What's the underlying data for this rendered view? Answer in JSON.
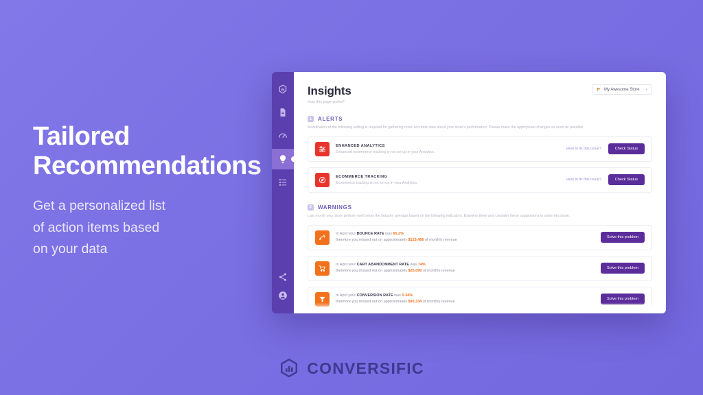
{
  "promo": {
    "title_line1": "Tailored",
    "title_line2": "Recommendations",
    "sub_line1": "Get a personalized list",
    "sub_line2": "of action items based",
    "sub_line3": "on your data"
  },
  "brand": {
    "name": "CONVERSIFIC",
    "logo_icon": "hexagon-bar-chart-icon",
    "color": "#3f3a8f"
  },
  "app": {
    "sidebar": {
      "items": [
        {
          "icon": "hexagon-logo-icon",
          "active": false
        },
        {
          "icon": "document-icon",
          "active": false
        },
        {
          "icon": "gauge-icon",
          "active": false
        },
        {
          "icon": "lightbulb-icon",
          "active": true
        },
        {
          "icon": "list-icon",
          "active": false
        }
      ],
      "bottom_items": [
        {
          "icon": "share-icon",
          "active": false
        },
        {
          "icon": "user-avatar-icon",
          "active": false
        }
      ]
    },
    "header": {
      "title": "Insights",
      "subtitle": "How this page works?",
      "store_selector": {
        "value": "My Awesome Store",
        "icon": "store-flag-icon",
        "caret": "chevron-down-icon"
      }
    },
    "sections": [
      {
        "number": "1",
        "title": "ALERTS",
        "description": "Modification of the following setting is required for gathering more accurate data about your store's performance. Please make the appropriate changes as soon as possible.",
        "cards": [
          {
            "icon": "sliders-icon",
            "icon_color": "#e8342c",
            "title": "ENHANCED ANALYTICS",
            "description": "Enhanced ecommerce tracking is not set up in your Analytics.",
            "link_label": "How to fix this issue?",
            "button_label": "Check Status"
          },
          {
            "icon": "compass-icon",
            "icon_color": "#e8342c",
            "title": "ECOMMERCE TRACKING",
            "description": "Ecommerce tracking is not set up in your Analytics.",
            "link_label": "How to fix this issue?",
            "button_label": "Check Status"
          }
        ]
      },
      {
        "number": "2",
        "title": "WARNINGS",
        "description": "Last month your store perform well below the industry average based on the following indicators. Examine them and consider these suggestions to solve this issue.",
        "cards": [
          {
            "icon": "bounce-rate-icon",
            "icon_color": "#f2711c",
            "line1_pre": "In April your ",
            "line1_metric": "BOUNCE RATE",
            "line1_mid": " was ",
            "line1_value": "65.2%",
            "line2_pre": "therefore you missed out on approximately ",
            "line2_value": "$123,456",
            "line2_post": " of monthly revenue",
            "button_label": "Solve this problem"
          },
          {
            "icon": "shopping-cart-icon",
            "icon_color": "#f2711c",
            "line1_pre": "In April your ",
            "line1_metric": "CART ABANDONMENT RATE",
            "line1_mid": " was ",
            "line1_value": "74%",
            "line2_pre": "therefore you missed out on approximately ",
            "line2_value": "$25,090",
            "line2_post": " of monthly revenue",
            "button_label": "Solve this problem"
          },
          {
            "icon": "conversion-funnel-icon",
            "icon_color": "#f2711c",
            "line1_pre": "In April your ",
            "line1_metric": "CONVERSION RATE",
            "line1_mid": " was ",
            "line1_value": "0.34%",
            "line2_pre": "therefore you missed out on approximately ",
            "line2_value": "$92,334",
            "line2_post": " of monthly revenue",
            "button_label": "Solve this problem"
          }
        ]
      }
    ]
  }
}
